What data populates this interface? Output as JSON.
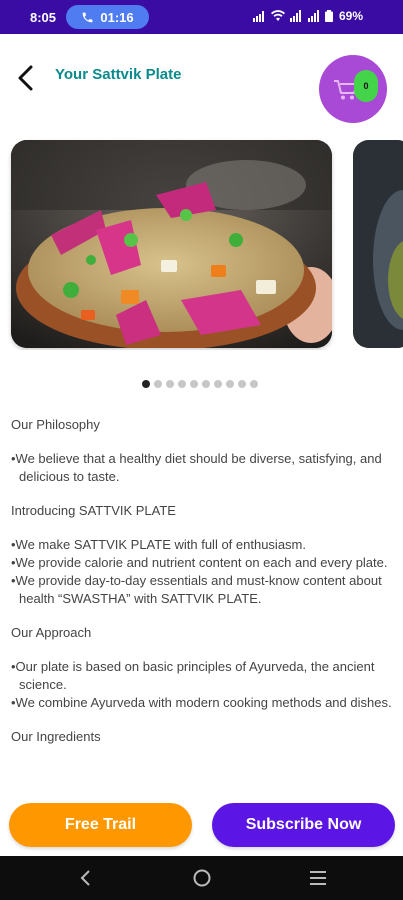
{
  "status_bar": {
    "time": "8:05",
    "call_time": "01:16",
    "battery": "69%"
  },
  "header": {
    "title": "Your Sattvik Plate",
    "cart_count": "0"
  },
  "carousel": {
    "dot_count": 10,
    "active_index": 0
  },
  "content": {
    "philosophy_heading": "Our Philosophy",
    "philosophy_items": [
      "•We believe that a healthy diet should be diverse, satisfying, and delicious to taste."
    ],
    "intro_heading": "Introducing SATTVIK PLATE",
    "intro_items": [
      "•We make SATTVIK PLATE with full of enthusiasm.",
      "•We provide calorie and nutrient content on each and every plate.",
      "•We provide day-to-day essentials and must-know content about health “SWASTHA” with SATTVIK PLATE."
    ],
    "approach_heading": "Our Approach",
    "approach_items": [
      "•Our plate is based on basic principles of Ayurveda, the ancient science.",
      "•We combine Ayurveda with modern cooking methods and dishes."
    ],
    "ingredients_heading": "Our Ingredients"
  },
  "buttons": {
    "trail": "Free Trail",
    "subscribe": "Subscribe Now"
  },
  "colors": {
    "status_bar": "#3a0ca3",
    "title": "#0a8a8c",
    "cart": "#a84ad6",
    "badge": "#44d44a",
    "trail": "#ff9800",
    "subscribe": "#5b16e6"
  }
}
